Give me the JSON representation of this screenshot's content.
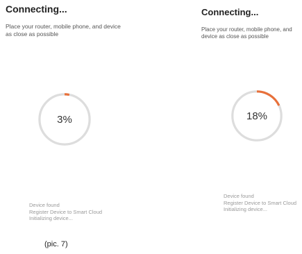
{
  "colors": {
    "accent": "#e8703a",
    "track": "#dddddd"
  },
  "screens": [
    {
      "title": "Connecting...",
      "instruction": "Place your router, mobile phone, and device as close as possible",
      "progress_text": "3%",
      "progress_percent": 3,
      "steps": [
        "Device found",
        "Register Device to Smart Cloud",
        "Initializing device..."
      ]
    },
    {
      "title": "Connecting...",
      "instruction": "Place your router, mobile phone, and device as close as possible",
      "progress_text": "18%",
      "progress_percent": 18,
      "steps": [
        "Device found",
        "Register Device to Smart Cloud",
        "Initializing device..."
      ]
    }
  ],
  "caption": "(pic. 7)"
}
